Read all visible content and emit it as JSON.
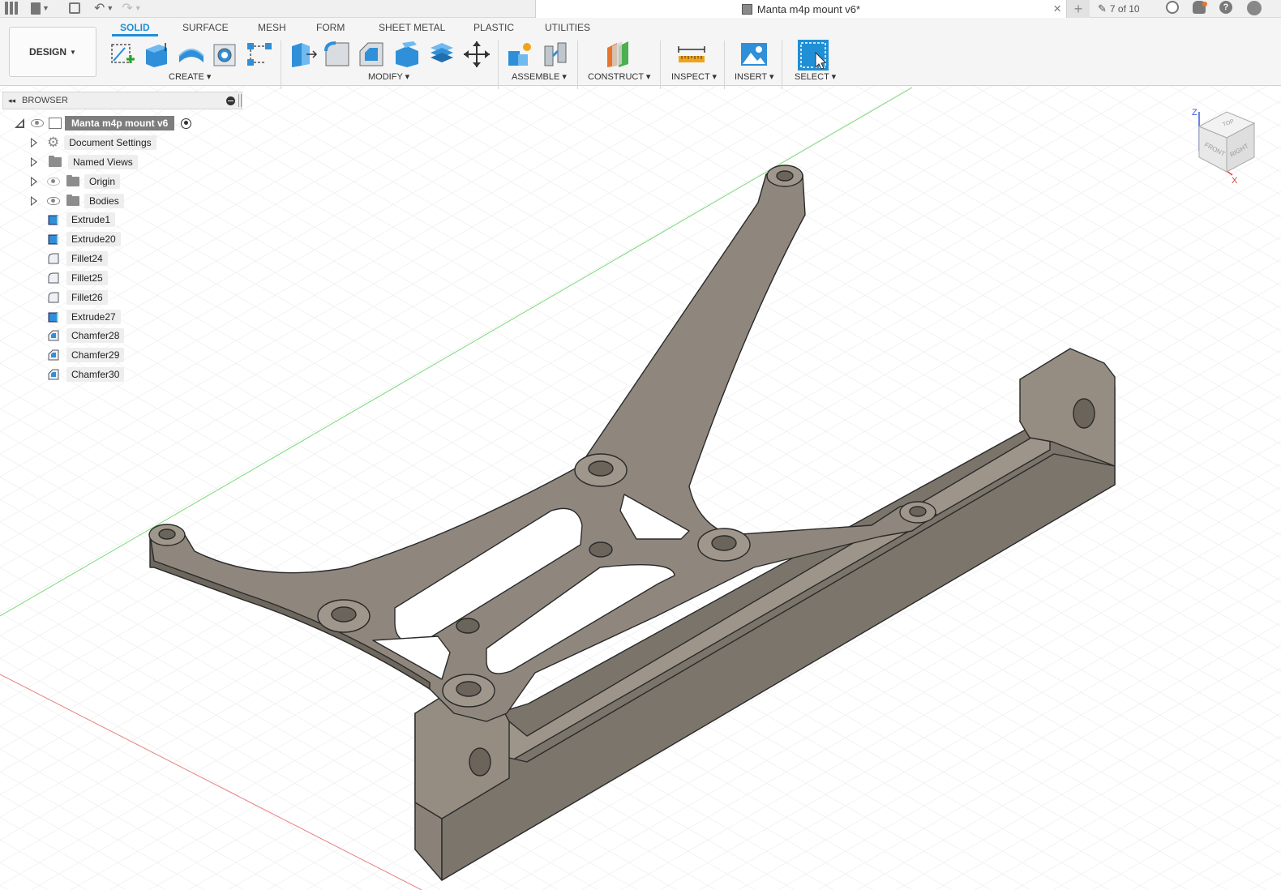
{
  "window": {
    "document_title": "Manta m4p mount v6*",
    "job_count": "7 of 10"
  },
  "toolbar": {
    "design_label": "DESIGN",
    "tabs": [
      "SOLID",
      "SURFACE",
      "MESH",
      "FORM",
      "SHEET METAL",
      "PLASTIC",
      "UTILITIES"
    ],
    "groups": {
      "create": "CREATE",
      "modify": "MODIFY",
      "assemble": "ASSEMBLE",
      "construct": "CONSTRUCT",
      "inspect": "INSPECT",
      "insert": "INSERT",
      "select": "SELECT"
    }
  },
  "browser": {
    "title": "BROWSER",
    "root": "Manta m4p mount v6",
    "nodes": [
      "Document Settings",
      "Named Views",
      "Origin",
      "Bodies"
    ],
    "features": [
      "Extrude1",
      "Extrude20",
      "Fillet24",
      "Fillet25",
      "Fillet26",
      "Extrude27",
      "Chamfer28",
      "Chamfer29",
      "Chamfer30"
    ]
  },
  "viewcube": {
    "z_label": "Z",
    "x_label": "X",
    "faces": {
      "top": "TOP",
      "front": "FRONT",
      "right": "RIGHT"
    }
  },
  "colors": {
    "accent": "#1f8fd6",
    "part_fill": "#8f877d",
    "part_edge": "#2a2a2a",
    "grid": "#e3e3e3",
    "axis_x": "#e05a5a",
    "axis_y": "#5ad65a"
  }
}
